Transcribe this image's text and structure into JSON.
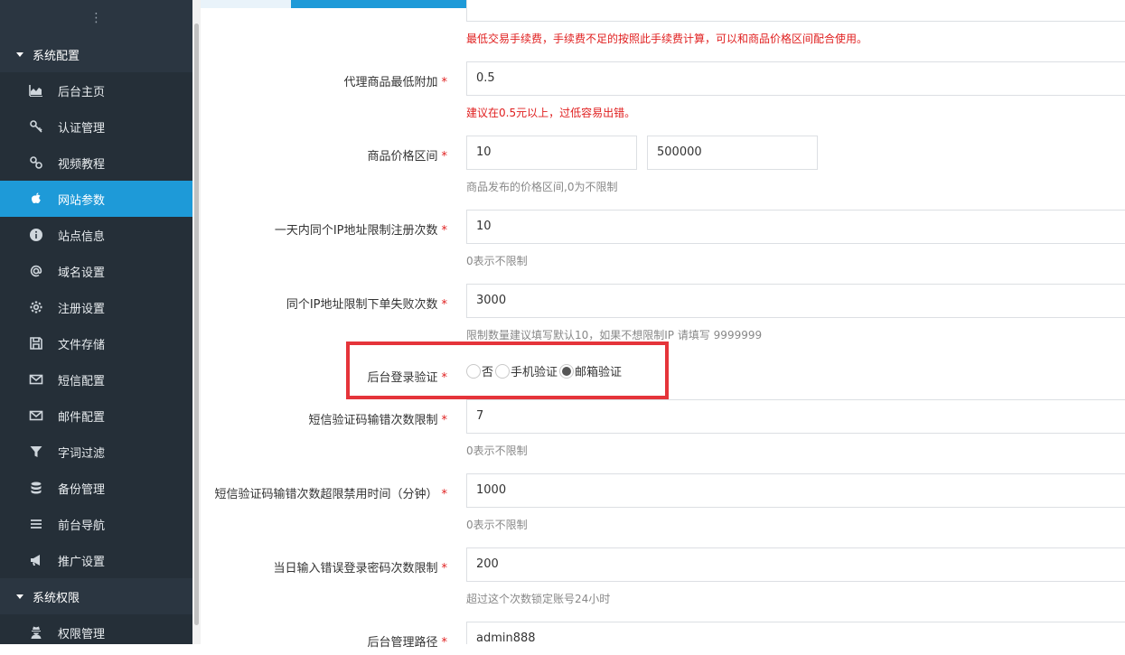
{
  "sidebar": {
    "groups": [
      {
        "label": "系统配置",
        "items": [
          {
            "label": "后台主页",
            "icon": "area-chart-icon"
          },
          {
            "label": "认证管理",
            "icon": "key-icon"
          },
          {
            "label": "视频教程",
            "icon": "link-icon"
          },
          {
            "label": "网站参数",
            "icon": "apple-icon",
            "active": true
          },
          {
            "label": "站点信息",
            "icon": "info-circle-icon"
          },
          {
            "label": "域名设置",
            "icon": "at-icon"
          },
          {
            "label": "注册设置",
            "icon": "gear-icon"
          },
          {
            "label": "文件存储",
            "icon": "floppy-disk-icon"
          },
          {
            "label": "短信配置",
            "icon": "envelope-icon"
          },
          {
            "label": "邮件配置",
            "icon": "envelope-icon"
          },
          {
            "label": "字词过滤",
            "icon": "filter-icon"
          },
          {
            "label": "备份管理",
            "icon": "database-icon"
          },
          {
            "label": "前台导航",
            "icon": "list-icon"
          },
          {
            "label": "推广设置",
            "icon": "bullhorn-icon"
          }
        ]
      },
      {
        "label": "系统权限",
        "items": [
          {
            "label": "权限管理",
            "icon": "user-secret-icon"
          }
        ]
      }
    ]
  },
  "form": {
    "fee_hint": "最低交易手续费，手续费不足的按照此手续费计算，可以和商品价格区间配合使用。",
    "agent_min_add": {
      "label": "代理商品最低附加",
      "value": "0.5",
      "hint": "建议在0.5元以上，过低容易出错。"
    },
    "price_range": {
      "label": "商品价格区间",
      "min": "10",
      "max": "500000",
      "hint": "商品发布的价格区间,0为不限制"
    },
    "ip_reg_limit": {
      "label": "一天内同个IP地址限制注册次数",
      "value": "10",
      "hint": "0表示不限制"
    },
    "ip_order_fail": {
      "label": "同个IP地址限制下单失败次数",
      "value": "3000",
      "hint": "限制数量建议填写默认10，如果不想限制IP 请填写 9999999"
    },
    "login_verify": {
      "label": "后台登录验证",
      "options": [
        "否",
        "手机验证",
        "邮箱验证"
      ],
      "selected": "邮箱验证"
    },
    "sms_err_limit": {
      "label": "短信验证码输错次数限制",
      "value": "7",
      "hint": "0表示不限制"
    },
    "sms_ban_time": {
      "label": "短信验证码输错次数超限禁用时间（分钟）",
      "value": "1000",
      "hint": "0表示不限制"
    },
    "pwd_err_limit": {
      "label": "当日输入错误登录密码次数限制",
      "value": "200",
      "hint": "超过这个次数锁定账号24小时"
    },
    "admin_path": {
      "label": "后台管理路径",
      "value": "admin888"
    },
    "required_mark": "*"
  },
  "colors": {
    "accent": "#1e9ad8",
    "sidebar": "#2b3641",
    "error": "#e02020",
    "highlight": "#e5343a"
  }
}
